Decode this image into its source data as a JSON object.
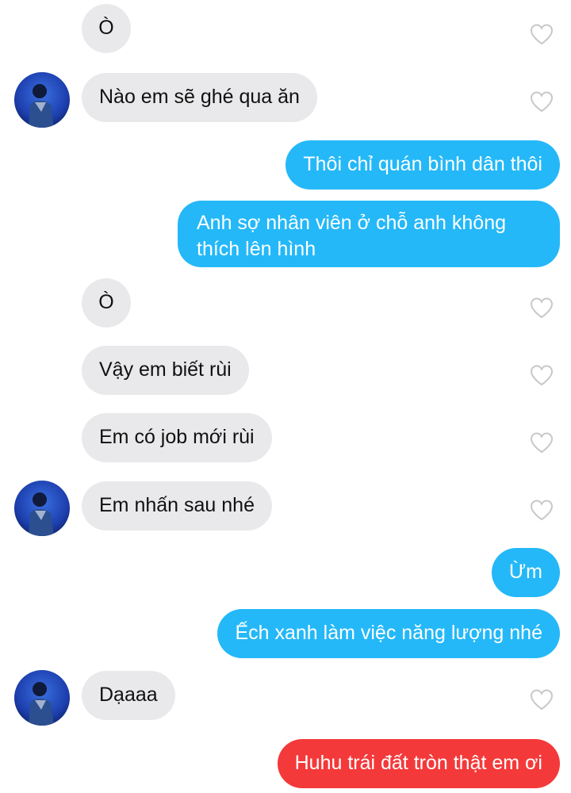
{
  "messages": [
    {
      "side": "in",
      "text": "Ò",
      "avatar": false
    },
    {
      "side": "in",
      "text": "Nào em sẽ ghé qua ăn",
      "avatar": true
    },
    {
      "side": "out",
      "text": "Thôi chỉ quán bình dân thôi"
    },
    {
      "side": "out",
      "text": "Anh sợ nhân viên ở chỗ anh không thích lên hình"
    },
    {
      "side": "in",
      "text": "Ò",
      "avatar": false
    },
    {
      "side": "in",
      "text": "Vậy em biết rùi",
      "avatar": false
    },
    {
      "side": "in",
      "text": "Em có job mới rùi",
      "avatar": false
    },
    {
      "side": "in",
      "text": "Em nhấn sau nhé",
      "avatar": true
    },
    {
      "side": "out",
      "text": "Ừm"
    },
    {
      "side": "out",
      "text": "Ếch xanh làm việc năng lượng nhé"
    },
    {
      "side": "in",
      "text": "Dạaaa",
      "avatar": true
    },
    {
      "side": "out",
      "text": "Huhu trái đất tròn thật em ơi",
      "highlight": true
    }
  ],
  "colors": {
    "incoming_bubble": "#e9e9eb",
    "outgoing_bubble": "#24b8f8",
    "highlight_bubble": "#f4393a",
    "heart_outline": "#c8c8c8"
  },
  "icons": {
    "like": "heart-outline-icon",
    "avatar": "profile-avatar"
  }
}
